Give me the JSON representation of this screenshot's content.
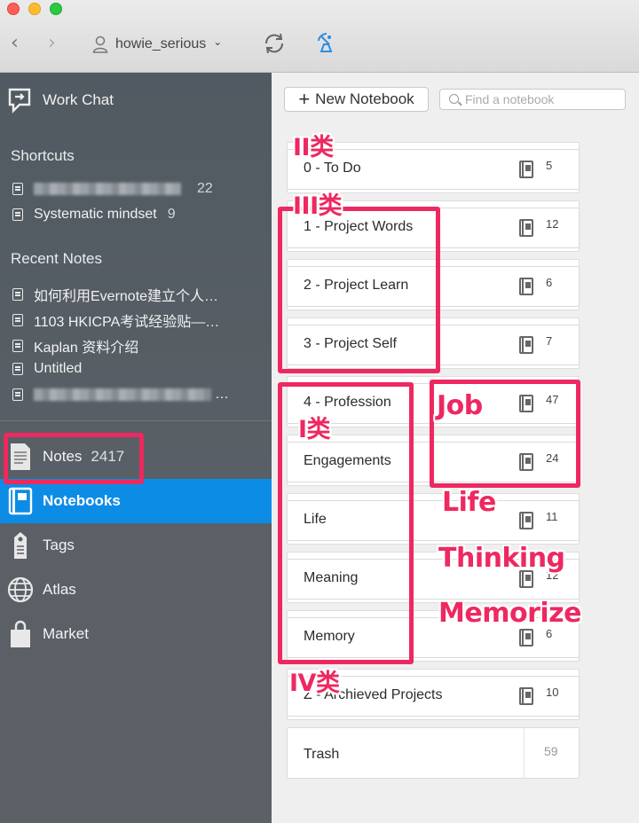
{
  "toolbar": {
    "back": "‹",
    "forward": "›",
    "username": "howie_serious",
    "caret": "⌄",
    "sync_icon": "sync-icon",
    "activity_icon": "satellite-icon"
  },
  "sidebar": {
    "work_chat": "Work Chat",
    "shortcuts_heading": "Shortcuts",
    "shortcuts": [
      {
        "label": "",
        "count": "22",
        "blurred": true
      },
      {
        "label": "Systematic mindset",
        "count": "9",
        "blurred": false
      }
    ],
    "recent_heading": "Recent Notes",
    "recent": [
      {
        "label": "如何利用Evernote建立个人…"
      },
      {
        "label": "1103 HKICPA考试经验贴—…"
      },
      {
        "label": "Kaplan 资料介绍"
      },
      {
        "label": "Untitled"
      },
      {
        "label": "…"
      }
    ],
    "nav": [
      {
        "label": "Notes",
        "count": "2417",
        "icon": "notes-icon"
      },
      {
        "label": "Notebooks",
        "count": "",
        "icon": "notebook-icon"
      },
      {
        "label": "Tags",
        "count": "",
        "icon": "tag-icon"
      },
      {
        "label": "Atlas",
        "count": "",
        "icon": "globe-icon"
      },
      {
        "label": "Market",
        "count": "",
        "icon": "shopping-bag-icon"
      }
    ]
  },
  "main": {
    "new_notebook": "New Notebook",
    "search_placeholder": "Find a notebook",
    "notebooks": [
      {
        "name": "0 - To Do",
        "count": "5"
      },
      {
        "name": "1 - Project Words",
        "count": "12"
      },
      {
        "name": "2 - Project Learn",
        "count": "6"
      },
      {
        "name": "3 - Project Self",
        "count": "7"
      },
      {
        "name": "4 - Profession",
        "count": "47"
      },
      {
        "name": "Engagements",
        "count": "24"
      },
      {
        "name": "Life",
        "count": "11"
      },
      {
        "name": "Meaning",
        "count": "12"
      },
      {
        "name": "Memory",
        "count": "6"
      },
      {
        "name": "Z - Archieved Projects",
        "count": "10"
      }
    ],
    "trash": {
      "name": "Trash",
      "count": "59"
    }
  },
  "annotations": {
    "ii": "II类",
    "iii": "III类",
    "i": "I类",
    "iv": "IV类",
    "job": "Job",
    "life": "Life",
    "thinking": "Thinking",
    "memorize": "Memorize"
  },
  "colors": {
    "accent": "#0d8ce6",
    "annotation": "#ee2860"
  }
}
